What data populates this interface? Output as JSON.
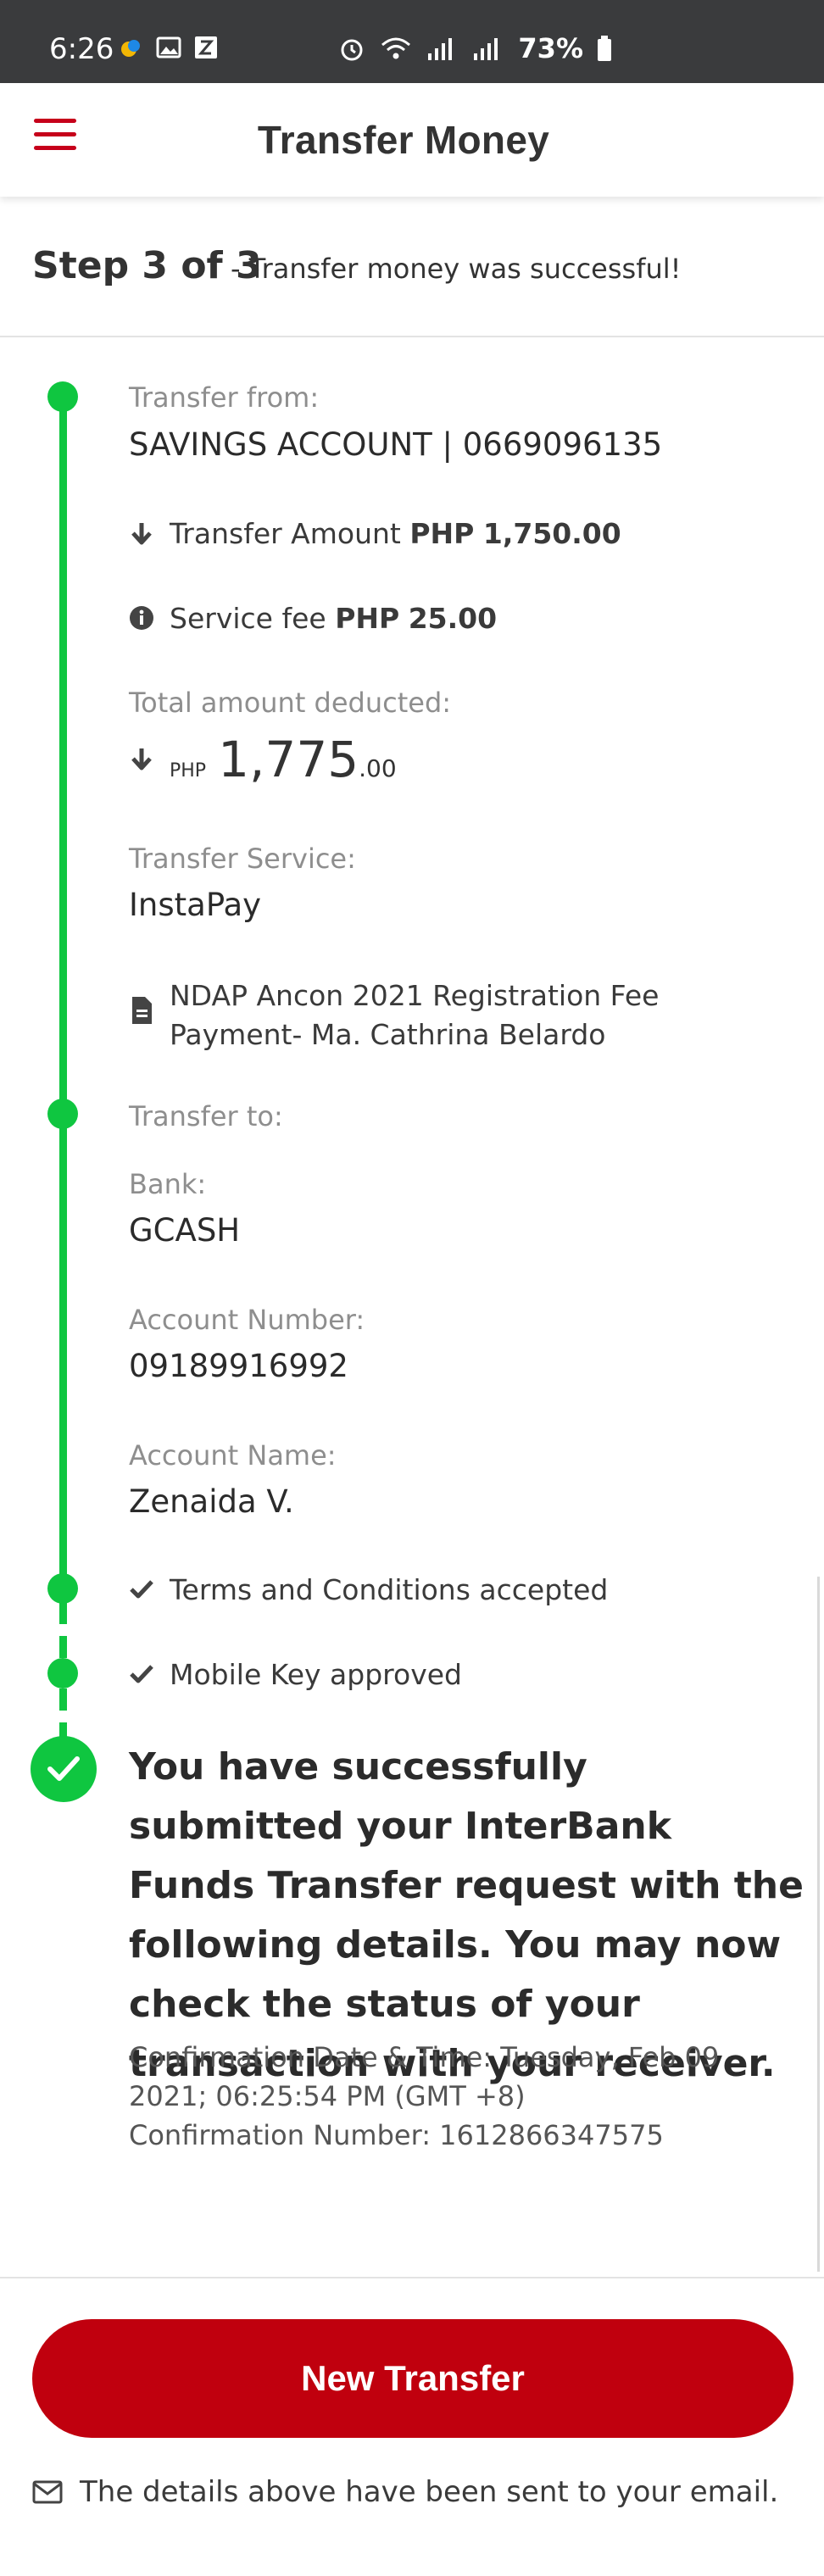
{
  "status_bar": {
    "time": "6:26",
    "battery": "73%"
  },
  "app_bar": {
    "title": "Transfer Money"
  },
  "step": {
    "number": "Step 3 of 3",
    "message": "- Transfer money was successful!"
  },
  "details": {
    "transfer_from_label": "Transfer from:",
    "transfer_from_value": "SAVINGS ACCOUNT | 0669096135",
    "transfer_amount_label": "Transfer Amount",
    "transfer_amount_currency": "PHP",
    "transfer_amount_value": "1,750.00",
    "service_fee_label": "Service fee",
    "service_fee_currency": "PHP",
    "service_fee_value": "25.00",
    "total_label": "Total amount deducted:",
    "total_currency": "PHP",
    "total_main": "1,775",
    "total_decimal": ".00",
    "service_label": "Transfer Service:",
    "service_value": "InstaPay",
    "remarks": "NDAP Ancon 2021 Registration Fee Payment- Ma. Cathrina Belardo",
    "transfer_to_label": "Transfer to:",
    "bank_label": "Bank:",
    "bank_value": "GCASH",
    "account_number_label": "Account Number:",
    "account_number_value": "09189916992",
    "account_name_label": "Account Name:",
    "account_name_value": "Zenaida V.",
    "terms_text": "Terms and Conditions accepted",
    "mobile_key_text": "Mobile Key approved"
  },
  "confirmation": {
    "message": "You have successfully submitted your InterBank Funds Transfer request with the following details. You may now check the status of your transaction with your receiver.",
    "date_line": "Confirmation Date & Time: Tuesday, Feb 09 2021; 06:25:54 PM (GMT +8)",
    "number_line": "Confirmation Number: 1612866347575"
  },
  "footer": {
    "new_transfer_label": "New Transfer",
    "email_note": "The details above have been sent to your email."
  },
  "colors": {
    "brand_red": "#c0000e",
    "menu_red": "#c6001a",
    "success_green": "#0fc640",
    "status_bar": "#3a3b3d"
  },
  "icons": [
    "menu-icon",
    "arrow-down-icon",
    "info-icon",
    "document-icon",
    "check-icon",
    "check-circle-icon",
    "mail-icon",
    "alarm-icon",
    "wifi-icon",
    "signal-icon",
    "battery-icon",
    "image-icon"
  ]
}
